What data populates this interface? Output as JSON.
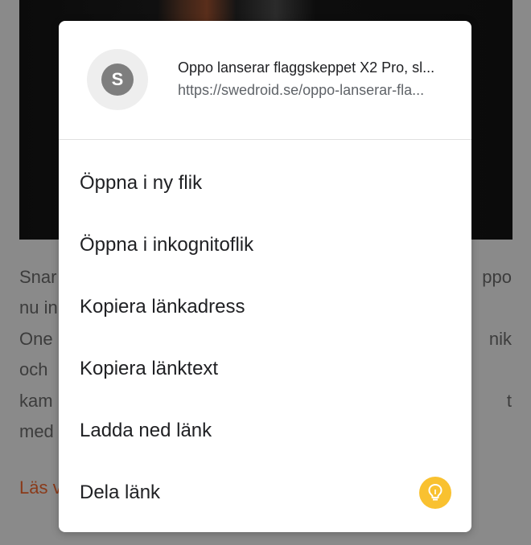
{
  "background": {
    "lines_left": [
      "Snar",
      "nu in",
      "One",
      "och",
      "kam",
      "med"
    ],
    "lines_right": [
      "ppo",
      "",
      "nik",
      "",
      "t",
      ""
    ],
    "link_left": "Läs v"
  },
  "dialog": {
    "favicon_letter": "S",
    "title": "Oppo lanserar flaggskeppet X2 Pro, sl...",
    "url": "https://swedroid.se/oppo-lanserar-fla...",
    "menu": [
      {
        "label": "Öppna i ny flik"
      },
      {
        "label": "Öppna i inkognitoflik"
      },
      {
        "label": "Kopiera länkadress"
      },
      {
        "label": "Kopiera länktext"
      },
      {
        "label": "Ladda ned länk"
      },
      {
        "label": "Dela länk",
        "icon": "lightbulb-icon"
      }
    ]
  },
  "colors": {
    "scrim": "#7a7a7a",
    "lightbulb": "#f9c130",
    "orange_link": "#8a3a19"
  }
}
